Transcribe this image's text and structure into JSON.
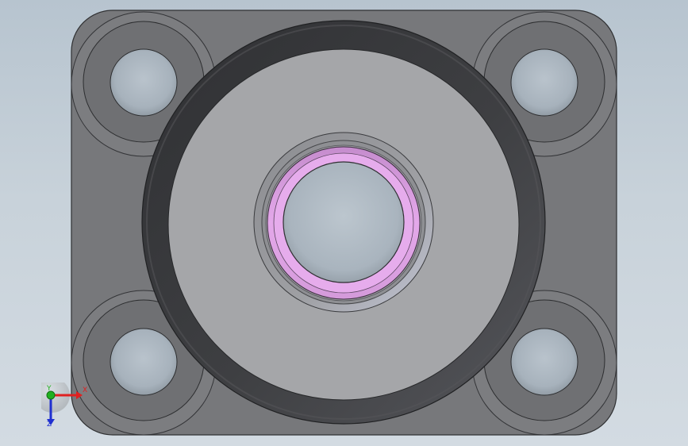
{
  "viewport": {
    "background_top": "#b7c4cf",
    "background_bottom": "#d3dbe2"
  },
  "part": {
    "body_color": "#78797c",
    "face_color": "#a5a6a9",
    "gasket_color": "#3f4043",
    "bore_highlight": "#d99ee0",
    "hole_color": "#a9b4be"
  },
  "triad": {
    "x_label": "X",
    "y_label": "Y",
    "z_label": "Z",
    "x_color": "#e02020",
    "y_color": "#20b020",
    "z_color": "#2030d0"
  }
}
